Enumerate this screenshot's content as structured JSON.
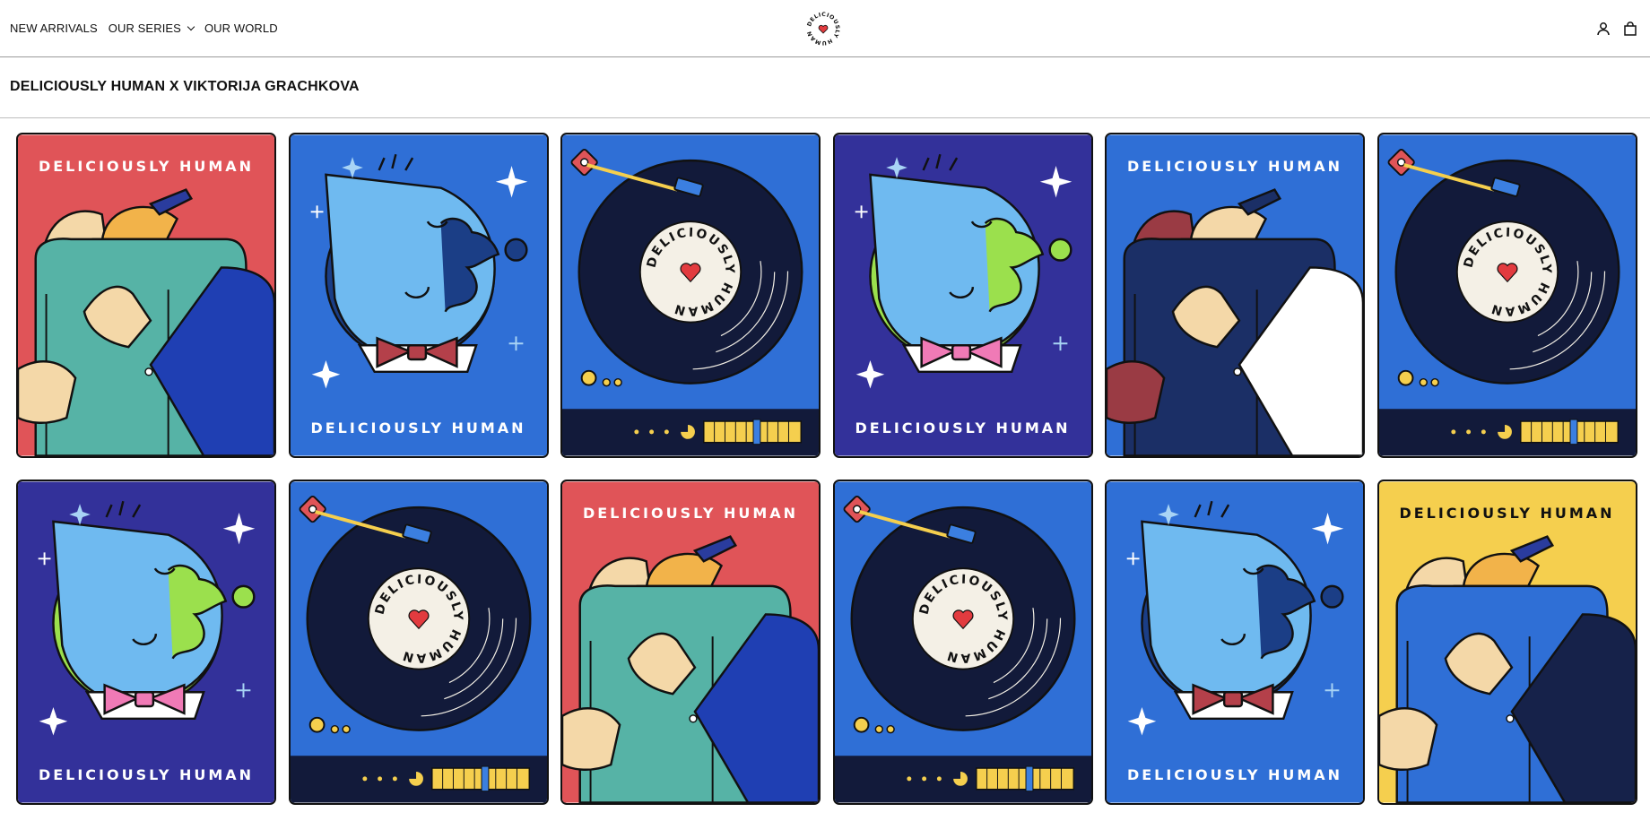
{
  "header": {
    "nav": [
      {
        "label": "NEW ARRIVALS",
        "has_dropdown": false
      },
      {
        "label": "OUR SERIES",
        "has_dropdown": true
      },
      {
        "label": "OUR WORLD",
        "has_dropdown": false
      }
    ],
    "logo_text": "DELICIOUSLY HUMAN",
    "icons": [
      "account-icon",
      "cart-icon"
    ]
  },
  "page": {
    "title": "DELICIOUSLY HUMAN X VIKTORIJA GRACHKOVA"
  },
  "colors": {
    "red": "#e05458",
    "blue": "#2f6fd6",
    "purple": "#33319a",
    "yellow": "#f5cf4e",
    "teal": "#56b3a6",
    "navy": "#121a3a",
    "ink": "#111111"
  },
  "products": [
    {
      "name": "hug-card",
      "label": "DELICIOUSLY HUMAN",
      "label_pos": "top",
      "background": "red"
    },
    {
      "name": "face-card",
      "label": "DELICIOUSLY HUMAN",
      "label_pos": "bottom",
      "background": "blue"
    },
    {
      "name": "record-card",
      "label": "",
      "label_pos": "none",
      "background": "blue",
      "record_text": "DELICIOUSLY HUMAN"
    },
    {
      "name": "face-card",
      "label": "DELICIOUSLY HUMAN",
      "label_pos": "bottom",
      "background": "purple"
    },
    {
      "name": "hug-card",
      "label": "DELICIOUSLY HUMAN",
      "label_pos": "top",
      "background": "blue"
    },
    {
      "name": "record-card",
      "label": "",
      "label_pos": "none",
      "background": "blue",
      "record_text": "DELICIOUSLY HUMAN"
    },
    {
      "name": "face-card",
      "label": "DELICIOUSLY HUMAN",
      "label_pos": "bottom",
      "background": "purple"
    },
    {
      "name": "record-card",
      "label": "",
      "label_pos": "none",
      "background": "blue",
      "record_text": "DELICIOUSLY HUMAN"
    },
    {
      "name": "hug-card",
      "label": "DELICIOUSLY HUMAN",
      "label_pos": "top",
      "background": "red"
    },
    {
      "name": "record-card",
      "label": "",
      "label_pos": "none",
      "background": "blue",
      "record_text": "DELICIOUSLY HUMAN"
    },
    {
      "name": "face-card",
      "label": "DELICIOUSLY HUMAN",
      "label_pos": "bottom",
      "background": "blue"
    },
    {
      "name": "hug-card",
      "label": "DELICIOUSLY HUMAN",
      "label_pos": "top",
      "background": "yellow"
    }
  ]
}
